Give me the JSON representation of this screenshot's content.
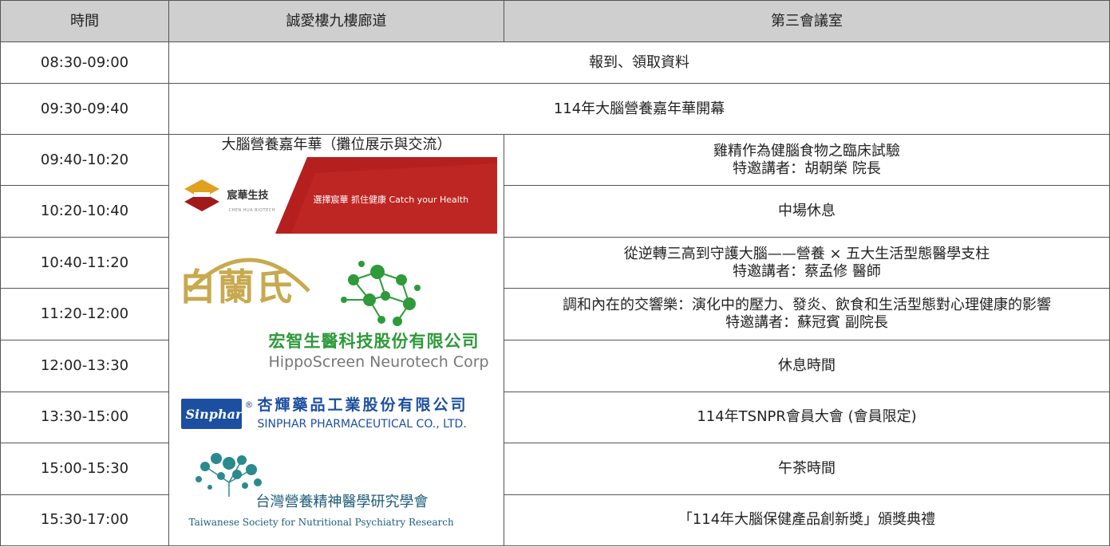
{
  "headers": [
    "時間",
    "誠愛樓九樓廊道",
    "第三會議室"
  ],
  "rows": [
    {
      "time": "08:30-09:00",
      "event": "報到、領取資料"
    },
    {
      "time": "09:30-09:40",
      "event": "114年大腦營養嘉年華開幕"
    },
    {
      "time": "09:40-10:20",
      "talk": "雞精作為健腦食物之臨床試驗",
      "speaker": "特邀講者：胡朝榮 院長"
    },
    {
      "time": "10:20-10:40",
      "talk": "中場休息"
    },
    {
      "time": "10:40-11:20",
      "talk": "從逆轉三高到守護大腦——營養 × 五大生活型態醫學支柱",
      "speaker": "特邀講者：蔡孟修 醫師"
    },
    {
      "time": "11:20-12:00",
      "talk": "調和內在的交響樂：演化中的壓力、發炎、飲食和生活型態對心理健康的影響",
      "speaker": "特邀講者：蘇冠賓 副院長"
    },
    {
      "time": "12:00-13:30",
      "talk": "休息時間"
    },
    {
      "time": "13:30-15:00",
      "talk": "114年TSNPR會員大會 (會員限定)"
    },
    {
      "time": "15:00-15:30",
      "talk": "午茶時間"
    },
    {
      "time": "15:30-17:00",
      "talk": "「114年大腦保健產品創新獎」頒獎典禮"
    }
  ],
  "sponsor": {
    "title": "大腦營養嘉年華（攤位展示與交流）",
    "chenhua": {
      "name": "宸華生技",
      "sub": "CHEN HUA BIOTECH",
      "slogan": "選擇宸華 抓住健康 Catch your Health"
    },
    "pailan": {
      "name": "白蘭氏"
    },
    "hippo": {
      "cn": "宏智生醫科技股份有限公司",
      "en": "HippoScreen Neurotech Corp"
    },
    "sinphar": {
      "logo": "Sinphar",
      "reg": "®",
      "cn": "杏輝藥品工業股份有限公司",
      "en": "SINPHAR PHARMACEUTICAL CO., LTD."
    },
    "tsnpr": {
      "cn": "台灣營養精神醫學研究學會",
      "en": "Taiwanese Society for Nutritional Psychiatry Research"
    }
  },
  "colors": {
    "header_bg": "#cfcfcf",
    "border": "#555555",
    "chenhua_red": "#b5201f",
    "pailan_gold": "#c8a94e",
    "hippo_green": "#2e9a3a",
    "sinphar_blue": "#1d4fa0",
    "tsnpr_teal": "#1e5c7a"
  }
}
